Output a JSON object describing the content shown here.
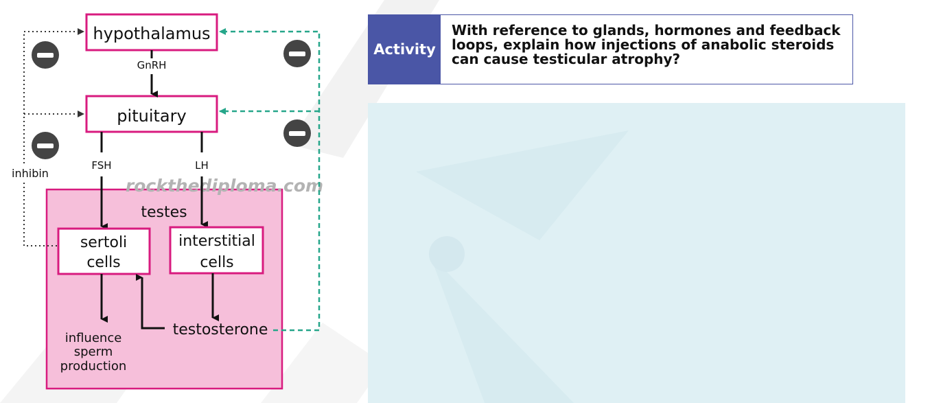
{
  "diagram": {
    "nodes": {
      "hypothalamus": "hypothalamus",
      "pituitary": "pituitary",
      "testes": "testes",
      "sertoli_line1": "sertoli",
      "sertoli_line2": "cells",
      "interstitial_line1": "interstitial",
      "interstitial_line2": "cells",
      "testosterone": "testosterone",
      "outcome_line1": "influence",
      "outcome_line2": "sperm",
      "outcome_line3": "production"
    },
    "edge_labels": {
      "gnrh": "GnRH",
      "fsh": "FSH",
      "lh": "LH",
      "inhibin": "inhibin"
    },
    "watermark": "rockthediploma.com",
    "colors": {
      "box_border": "#d81b7f",
      "testes_fill": "#f6bfda",
      "testosterone_feedback": "#26a68a",
      "inhibitor_badge": "#444444"
    }
  },
  "activity": {
    "label": "Activity",
    "question": "With reference to glands, hormones and feedback loops, explain how injections of anabolic steroids can cause testicular atrophy?",
    "accent": "#4a56a6"
  },
  "answer_panel": {
    "background": "#dff0f4"
  }
}
